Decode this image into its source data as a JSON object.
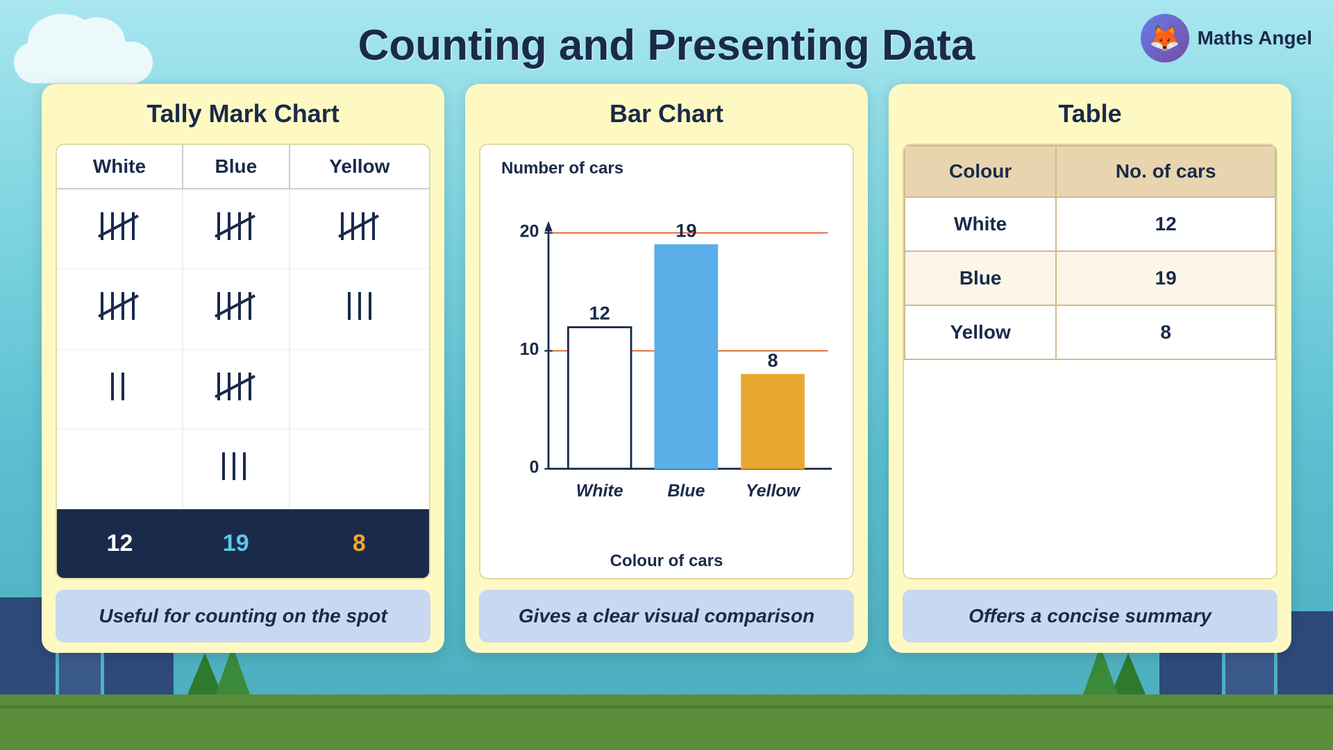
{
  "page": {
    "title": "Counting and Presenting Data",
    "logo": {
      "text": "Maths Angel",
      "emoji": "🦊"
    }
  },
  "tally_panel": {
    "heading": "Tally Mark Chart",
    "columns": [
      "White",
      "Blue",
      "Yellow"
    ],
    "footer": "Useful for counting on the spot",
    "totals": [
      "12",
      "19",
      "8"
    ]
  },
  "bar_chart_panel": {
    "heading": "Bar Chart",
    "y_label": "Number of cars",
    "x_label": "Colour of cars",
    "footer": "Gives a clear visual comparison",
    "bars": [
      {
        "label": "White",
        "value": 12,
        "color": "#ffffff",
        "stroke": "#333"
      },
      {
        "label": "Blue",
        "value": 19,
        "color": "#5baee8",
        "stroke": "#5baee8"
      },
      {
        "label": "Yellow",
        "value": 8,
        "color": "#e8a830",
        "stroke": "#e8a830"
      }
    ],
    "y_ticks": [
      0,
      10,
      20
    ]
  },
  "table_panel": {
    "heading": "Table",
    "col1": "Colour",
    "col2": "No. of cars",
    "footer": "Offers a concise summary",
    "rows": [
      {
        "colour": "White",
        "count": "12"
      },
      {
        "colour": "Blue",
        "count": "19"
      },
      {
        "colour": "Yellow",
        "count": "8"
      }
    ]
  }
}
